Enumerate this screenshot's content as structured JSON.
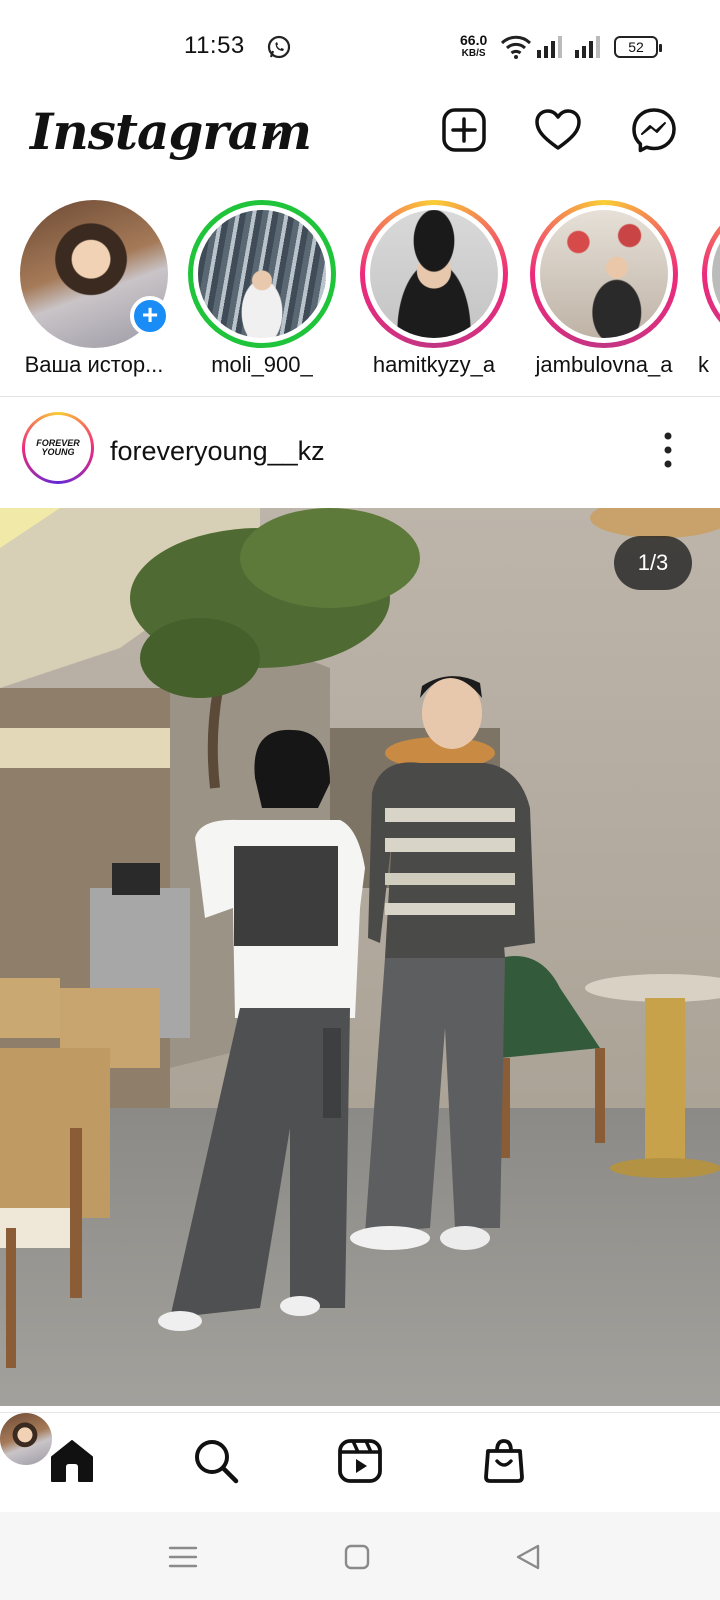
{
  "status_bar": {
    "time": "11:53",
    "net_speed": "66.0",
    "net_unit": "KB/S",
    "battery": "52"
  },
  "header": {
    "logo": "Instagram"
  },
  "stories": [
    {
      "label": "Ваша истор...",
      "ring": "none"
    },
    {
      "label": "moli_900_",
      "ring": "close-friends"
    },
    {
      "label": "hamitkyzy_a",
      "ring": "gradient"
    },
    {
      "label": "jambulovna_a",
      "ring": "gradient"
    },
    {
      "label": "k",
      "ring": "gradient"
    }
  ],
  "post": {
    "username": "foreveryoung__kz",
    "avatar_text": "FOREVER YOUNG",
    "counter": "1/3"
  },
  "colors": {
    "story_gradient": "#ee2a7b",
    "close_friends": "#1fc43b",
    "badge": "#1a8cf5"
  }
}
